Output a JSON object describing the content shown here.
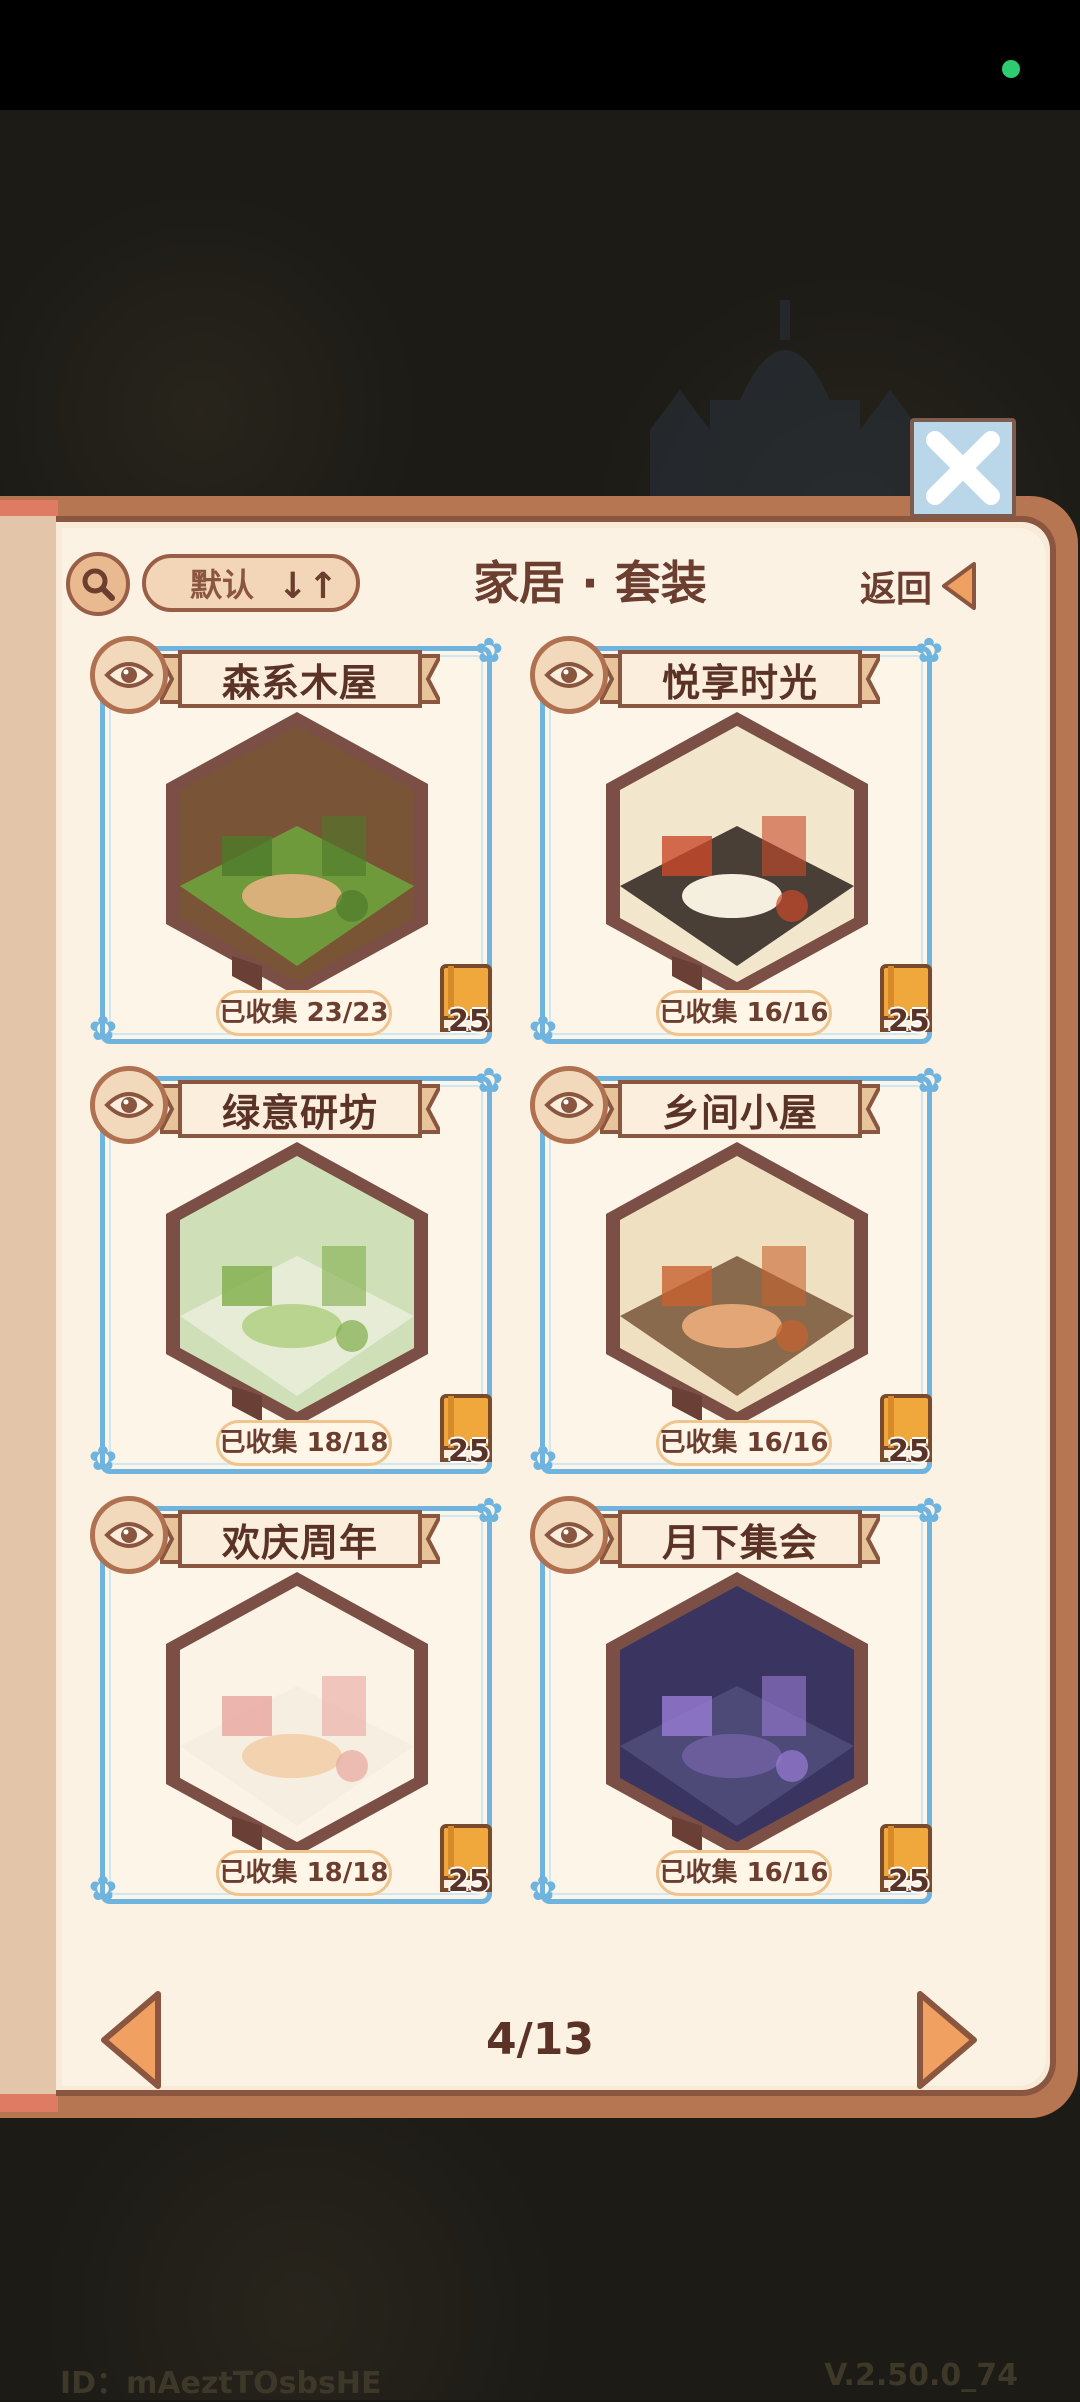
{
  "header": {
    "sort_label": "默认",
    "sort_icon": "↓↑",
    "title": "家居 · 套装",
    "back_label": "返回"
  },
  "sets": [
    {
      "name": "森系木屋",
      "collected": "已收集 23/23",
      "book_count": "25",
      "theme": "forest"
    },
    {
      "name": "悦享时光",
      "collected": "已收集 16/16",
      "book_count": "25",
      "theme": "cream"
    },
    {
      "name": "绿意研坊",
      "collected": "已收集 18/18",
      "book_count": "25",
      "theme": "green"
    },
    {
      "name": "乡间小屋",
      "collected": "已收集 16/16",
      "book_count": "25",
      "theme": "rustic"
    },
    {
      "name": "欢庆周年",
      "collected": "已收集 18/18",
      "book_count": "25",
      "theme": "party"
    },
    {
      "name": "月下集会",
      "collected": "已收集 16/16",
      "book_count": "25",
      "theme": "purple"
    }
  ],
  "pagination": {
    "current": "4/13"
  },
  "footer": {
    "id_text": "ID：mAeztTOsbsHE",
    "version": "V.2.50.0_74"
  },
  "colors": {
    "frame_blue": "#6fb4de",
    "page_bg": "#fbf2e4",
    "brown_text": "#5a3326",
    "book_orange": "#f0a83c"
  }
}
